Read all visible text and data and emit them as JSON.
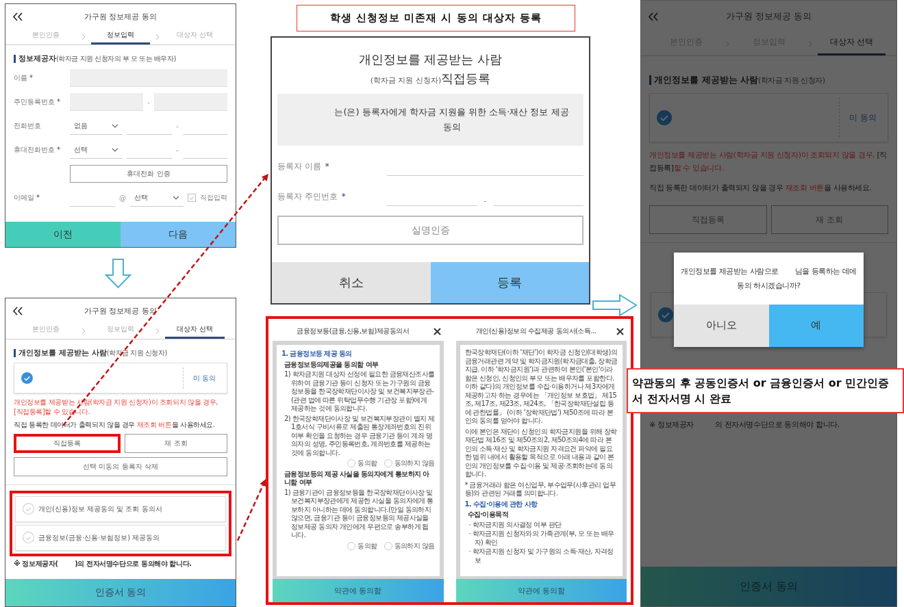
{
  "form_screen": {
    "title": "가구원 정보제공 동의",
    "steps": [
      {
        "label": "본인인증",
        "selected": false
      },
      {
        "label": "정보입력",
        "selected": true
      },
      {
        "label": "대상자 선택",
        "selected": false
      }
    ],
    "section_title": "정보제공자",
    "section_note": "(학자금 지원 신청자의 부 모 또는 배우자)",
    "fields": [
      {
        "kind": "text",
        "label": "이름",
        "mark": "*"
      },
      {
        "kind": "split",
        "label": "주민등록번호",
        "mark": "*",
        "separator": "-"
      },
      {
        "kind": "phone",
        "label": "전화번호",
        "select": "없음",
        "separator": "-"
      },
      {
        "kind": "phone",
        "label": "휴대전화번호",
        "mark": "*",
        "select": "선택",
        "separator": "-"
      },
      {
        "kind": "button",
        "label": "휴대전화 인증"
      },
      {
        "kind": "email",
        "label": "이메일",
        "mark": "*",
        "at": "@",
        "select": "선택",
        "checkbox": {
          "label": "직접입력",
          "checked": false
        }
      }
    ],
    "buttons": [
      {
        "label": "이전",
        "kind": "secondary"
      },
      {
        "label": "다음",
        "kind": "primary"
      }
    ]
  },
  "target_screen": {
    "title": "가구원 정보제공 동의",
    "steps": [
      {
        "label": "본인인증",
        "selected": false
      },
      {
        "label": "정보입력",
        "selected": false
      },
      {
        "label": "대상자 선택",
        "selected": true
      }
    ],
    "section_title": "개인정보를 제공받는 사람",
    "section_note": "(학자금 지원 신청자)",
    "recipient": {
      "checked": true,
      "status": "미 동의"
    },
    "notice": [
      [
        {
          "text": "개인정보를 제공받는 사람(학자금 지원 신청자)이 조회되지 않을 경우, [직접등록]할 수 있습니다.",
          "red": true
        }
      ],
      [
        {
          "text": "직접 등록한 데이터가 출력되지 않을 경우 ",
          "red": false
        },
        {
          "text": "재조회 버튼",
          "red": true
        },
        {
          "text": "을 사용하세요.",
          "red": false
        }
      ]
    ],
    "actions": [
      {
        "label": "직접등록",
        "highlighted": true
      },
      {
        "label": "재 조회",
        "highlighted": false
      }
    ],
    "wide_action": {
      "label": "선택 미동의 등록자 삭제"
    },
    "entries_highlighted": true,
    "entries": [
      {
        "kind": "consent",
        "label": "개인(신용)정보 제공동의 및 조회 동의서",
        "checked": false
      },
      {
        "kind": "consent",
        "label": "금융정보(금융·신용·보험정보) 제공동의",
        "checked": false
      }
    ],
    "footnote": "※ 정보제공자(        )의 전자서명수단으로 동의해야 합니다.",
    "submit": "인증서 동의"
  },
  "register_modal": {
    "title": "개인정보를 제공받는 사람",
    "subtitle_note": "(학자금 지원 신청자)",
    "subtitle": "직접등록",
    "consent_text": "는(은) 등록자에게 학자금 지원을 위한 소득·재산 정보 제공 동의",
    "fields": [
      {
        "kind": "text",
        "label": "등록자 이름",
        "mark": "*"
      },
      {
        "kind": "split",
        "label": "등록자 주민번호",
        "mark": "*",
        "separator": "-"
      }
    ],
    "verify_button": "실명인증",
    "buttons": [
      {
        "label": "취소",
        "kind": "secondary"
      },
      {
        "label": "등록",
        "kind": "primary"
      }
    ]
  },
  "terms_sheets": [
    {
      "title": "금융정보등(금융,신용,보험)제공동의서",
      "blocks": [
        {
          "kind": "heading",
          "text": "1. 금융정보등 제공 동의"
        },
        {
          "kind": "subheading",
          "text": "금융정보등의제공을 동의함 여부"
        },
        {
          "kind": "item",
          "text": "1) 학자금지원 대상자 선정에 필요한 금융재산조사를 위하여 금융기관 등이 신청자 또는 가구원의 금융정보등을 한국장학재단이사장 및 보건복지부장관-(관련 법에 따른 위탁업무수행 기관장 포함)에게 제공하는 것에 동의합니다."
        },
        {
          "kind": "item",
          "text": "2) 한국장학재단이사장 및 보건복지부장관이 별지 제1호서식 구비서류로 제출된 통장계좌번호의 진위 여부 확인을 요청하는 경우 금융기관 등이 계좌 명의자의 성명, 주민등록번호, 계좌번호를 제공하는 것에 동의합니다."
        },
        {
          "kind": "radios",
          "options": [
            {
              "label": "동의함",
              "selected": false
            },
            {
              "label": "동의하지 않음",
              "selected": false
            }
          ]
        },
        {
          "kind": "subheading",
          "text": "금융정보등의 제공 사실을 동의자에게 통보하지 아니함 여부"
        },
        {
          "kind": "item",
          "text": "1) 금융기관이 금융정보등을 한국장학재단이사장 및 보건복지부장관에게 제공한 사실을 동의자에게 통보하지 아니하는 데에 동의합니다.(만일 동의하지 않으면, 금융기관 등이 금융정보등의 제공사실을 정보제공 동의자 개인에게 우편으로 송부하게 됩니다."
        },
        {
          "kind": "radios",
          "options": [
            {
              "label": "동의함",
              "selected": false
            },
            {
              "label": "동의하지 않음",
              "selected": false
            }
          ]
        }
      ],
      "button": "약관에 동의함"
    },
    {
      "title": "개인(신용)정보의 수집제공 동의서(소득...",
      "blocks": [
        {
          "kind": "paragraph",
          "text": "한국장학재단(이하 '재단')이 학자금 신청인(대학생)의 금융거래관련 계약 및 학자금지원(학자금대출, 장학금지급. 이하 '학자금지원')과 관련하여 본인('본인'이라함은 신청인, 신청인의 부모 또는 배우자를 포함한다. 이하 같다)의 개인정보를 수집·이용하거나 제3자에게 제공하고자 하는 경우에는 「개인정보 보호법」 제15조, 제17조, 제23조, 제24조, 「한국장학재단설립 등에 관한법률」 (이하 '장학재단법') 제50조에 따라 본인의 동의를 얻어야 합니다."
        },
        {
          "kind": "paragraph",
          "text": "이에 본인은 재단이 신청인의 학자금지원을 위해 장학재단법 제16조 및 제50조의2, 제50조의4에 따라 본인의 소득·재산 및 학자금지원 자격요건 파악에 필요한 범위 내에서 활용할 목적으로 아래 내용과 같이 본인의 개인정보를 수집·이용 및 제공·조회하는데 동의합니다."
        },
        {
          "kind": "paragraph",
          "text": "* 금융거래라 함은 여신업무, 부수업무(사후관리 업무 등)와 관련된 거래를 의미합니다."
        },
        {
          "kind": "heading",
          "text": "1. 수집·이용에 관한 사항"
        },
        {
          "kind": "subheading",
          "text": "수집·이용목적"
        },
        {
          "kind": "bullet",
          "text": "· 학자금지원 의사결정 여부 판단"
        },
        {
          "kind": "bullet",
          "text": "· 학자금지원 신청자와의 가족관계(부, 모 또는 배우자) 확인"
        },
        {
          "kind": "bullet",
          "text": "· 학자금지원 신청자 및 가구원의 소득·재산, 자격정보"
        }
      ],
      "button": "약관에 동의함"
    }
  ],
  "confirm_screen": {
    "title": "가구원 정보제공 동의",
    "steps": [
      {
        "label": "본인인증",
        "selected": false
      },
      {
        "label": "정보입력",
        "selected": false
      },
      {
        "label": "대상자 선택",
        "selected": true
      }
    ],
    "section_title": "개인정보를 제공받는 사람",
    "section_note": "(학자금 지원 신청자)",
    "recipient": {
      "checked": true,
      "status": "미 동의"
    },
    "notice": [
      [
        {
          "text": "개인정보를 제공받는 사람(학자금 지원 신청자)이 조회되지 않을 경우, ",
          "red": true
        },
        {
          "text": "[직접등록]",
          "red": false
        },
        {
          "text": "할 수 있습니다.",
          "red": true
        }
      ],
      [
        {
          "text": "직접 등록한 데이터가 출력되지 않을 경우 ",
          "red": false
        },
        {
          "text": "재조회 버튼",
          "red": true
        },
        {
          "text": "을 사용하세요.",
          "red": false
        }
      ]
    ],
    "actions": [
      {
        "label": "직접등록",
        "highlighted": false
      },
      {
        "label": "재 조회",
        "highlighted": false
      }
    ],
    "entries_highlighted": false,
    "entries": [
      {
        "kind": "recipient",
        "checked": true
      }
    ],
    "footnote": "※ 정보제공자          의 전자서명수단으로 동의해야 합니다.",
    "submit": "인증서 동의",
    "dialog": {
      "message": "개인정보를 제공받는 사람으로        님을 등록하는 데에 동의 하시겠습니까?",
      "buttons": [
        {
          "label": "아니오",
          "kind": "secondary"
        },
        {
          "label": "예",
          "kind": "primary"
        }
      ]
    }
  },
  "callouts": [
    {
      "text": "학생 신청정보 미존재 시 동의 대상자 등록"
    },
    {
      "text": "약관동의 후 공동인증서 or 금융인증서 or 민간인증서 전자서명 시 완료"
    }
  ]
}
